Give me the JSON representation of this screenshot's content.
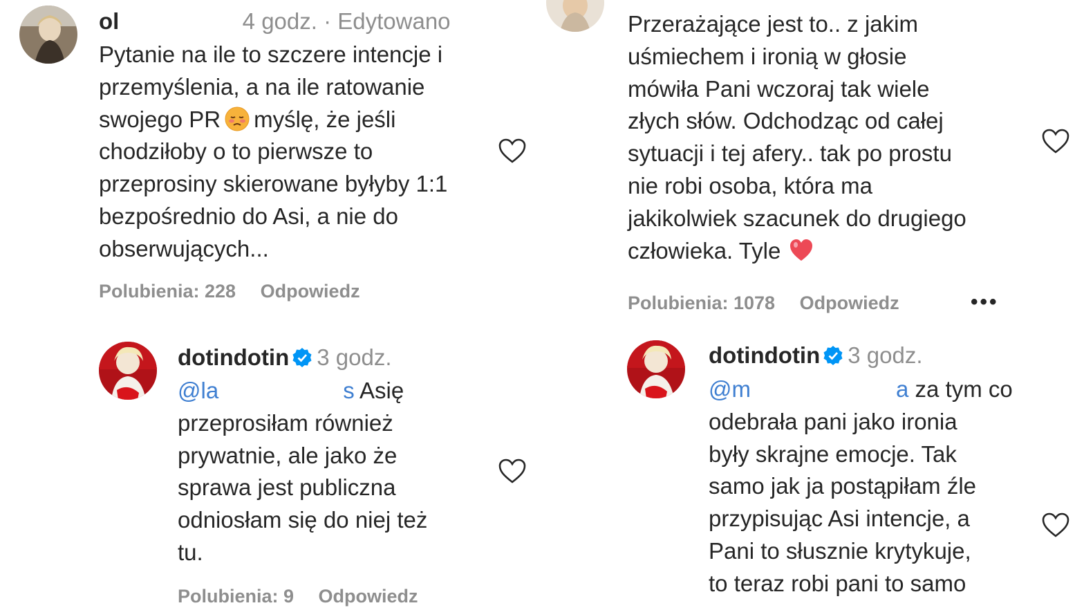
{
  "left_column": {
    "comment": {
      "username": "ol",
      "time": "4 godz.",
      "edited_label": "· Edytowano",
      "lines": [
        "Pytanie na ile to szczere intencje i",
        "przemyślenia, a na ile ratowanie",
        "swojego PR",
        "myślę, że jeśli",
        "chodziłoby o to pierwsze to",
        "przeprosiny skierowane byłyby 1:1",
        "bezpośrednio do Asi, a nie do",
        "obserwujących..."
      ],
      "likes_label": "Polubienia: 228",
      "reply_label": "Odpowiedz",
      "emoji_icon": "sad-face-emoji"
    },
    "reply": {
      "username": "dotindotin",
      "time": "3 godz.",
      "mention_start": "@la",
      "mention_end": "s",
      "lines": [
        "Asię",
        "przeprosiłam również",
        "prywatnie, ale jako że",
        "sprawa jest publiczna",
        "odniosłam się do niej też",
        "tu."
      ],
      "likes_label": "Polubienia: 9",
      "reply_label": "Odpowiedz"
    }
  },
  "right_column": {
    "comment": {
      "lines": [
        "Przerażające jest to.. z jakim",
        "uśmiechem i ironią w głosie",
        "mówiła Pani wczoraj tak wiele",
        "złych słów. Odchodząc od całej",
        "sytuacji i tej afery.. tak po prostu",
        "nie robi osoba, która ma",
        "jakikolwiek szacunek do drugiego",
        "człowieka. Tyle"
      ],
      "likes_label": "Polubienia: 1078",
      "reply_label": "Odpowiedz",
      "more_label": "•••",
      "emoji_icon": "pink-heart-emoji"
    },
    "reply": {
      "username": "dotindotin",
      "time": "3 godz.",
      "mention_start": "@m",
      "mention_end": "a",
      "lines": [
        "za tym co",
        "odebrała pani jako ironia",
        "były skrajne emocje. Tak",
        "samo jak ja postąpiłam źle",
        "przypisując Asi intencje, a",
        "Pani to słusznie krytykuje,",
        "to teraz robi pani to samo"
      ]
    }
  },
  "colors": {
    "text": "#262626",
    "muted": "#8e8e8e",
    "mention": "#3f7fd1",
    "verified": "#0095f6",
    "heart_emoji": "#ed4956"
  }
}
